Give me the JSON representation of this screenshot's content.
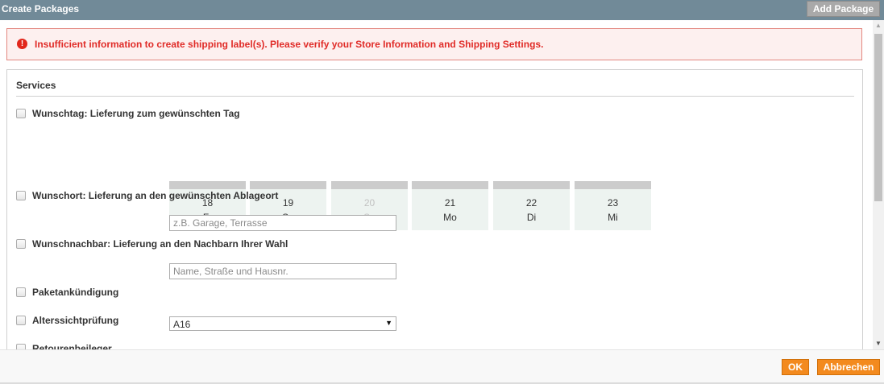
{
  "header": {
    "title": "Create Packages",
    "add_package_label": "Add Package"
  },
  "error": {
    "message": "Insufficient information to create shipping label(s). Please verify your Store Information and Shipping Settings."
  },
  "services": {
    "title": "Services",
    "wunschtag": {
      "label": "Wunschtag: Lieferung zum gewünschten Tag",
      "days": [
        {
          "num": "18",
          "name": "Fr",
          "disabled": false
        },
        {
          "num": "19",
          "name": "Sa",
          "disabled": false
        },
        {
          "num": "20",
          "name": "So",
          "disabled": true
        },
        {
          "num": "21",
          "name": "Mo",
          "disabled": false
        },
        {
          "num": "22",
          "name": "Di",
          "disabled": false
        },
        {
          "num": "23",
          "name": "Mi",
          "disabled": false
        }
      ]
    },
    "wunschort": {
      "label": "Wunschort: Lieferung an den gewünschten Ablageort",
      "placeholder": "z.B. Garage, Terrasse",
      "value": ""
    },
    "wunschnachbar": {
      "label": "Wunschnachbar: Lieferung an den Nachbarn Ihrer Wahl",
      "placeholder": "Name, Straße und Hausnr.",
      "value": ""
    },
    "paketankuendigung": {
      "label": "Paketankündigung"
    },
    "alterssichtpruefung": {
      "label": "Alterssichtprüfung",
      "selected": "A16"
    },
    "retourenbeileger": {
      "label": "Retourenbeileger"
    }
  },
  "footer": {
    "ok_label": "OK",
    "cancel_label": "Abbrechen"
  },
  "colors": {
    "header_bg": "#718a98",
    "error_text": "#e02b27",
    "error_bg": "#fdf0ef",
    "button_orange": "#f38a1e"
  }
}
